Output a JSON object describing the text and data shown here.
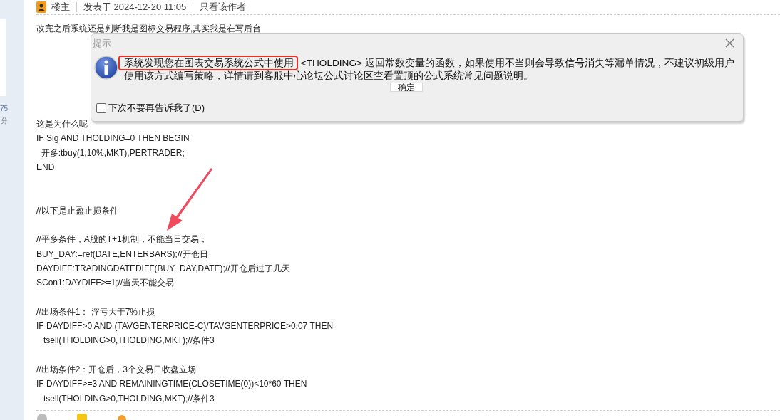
{
  "sidebar": {
    "stat_value": "75",
    "stat_unit": "分"
  },
  "post_header": {
    "role": "楼主",
    "posted": "发表于 2024-12-20 11:05",
    "author_only": "只看该作者"
  },
  "post_intro": "改完之后系统还是判断我是图标交易程序,其实我是在写后台",
  "dialog": {
    "title": "提示",
    "message_highlighted": "系统发现您在图表交易系统公式中使用",
    "message_rest": " <THOLDING> 返回常数变量的函数，如果使用不当则会导致信号消失等漏单情况，不建议初级用户使用该方式编写策略，详情请到客服中心论坛公式讨论区查看置顶的公式系统常见问题说明。",
    "ok_button": "确定",
    "dont_show_again": {
      "label": "下次不要再告诉我了(D)",
      "checked": false
    }
  },
  "code_blocks": [
    {
      "kind": "first",
      "lines": [
        "这是为什么呢",
        "IF Sig AND THOLDING=0 THEN BEGIN",
        "  开多:tbuy(1,10%,MKT),PERTRADER;",
        "END"
      ]
    },
    {
      "kind": "wide",
      "lines": [
        "//以下是止盈止损条件"
      ]
    },
    {
      "kind": "spaced",
      "lines": [
        "//平多条件，A股的T+1机制，不能当日交易；",
        "BUY_DAY:=ref(DATE,ENTERBARS);//开仓日",
        "DAYDIFF:TRADINGDATEDIFF(BUY_DAY,DATE);//开仓后过了几天",
        "SCon1:DAYDIFF>=1;//当天不能交易"
      ]
    },
    {
      "kind": "spaced",
      "lines": [
        "//出场条件1： 浮亏大于7%止损",
        "IF DAYDIFF>0 AND (TAVGENTERPRICE-C)/TAVGENTERPRICE>0.07 THEN",
        "   tsell(THOLDING>0,THOLDING,MKT);//条件3"
      ]
    },
    {
      "kind": "spaced",
      "lines": [
        "//出场条件2：开仓后，3个交易日收盘立场",
        "IF DAYDIFF>=3 AND REMAININGTIME(CLOSETIME(0))<10*60 THEN",
        "   tsell(THOLDING>0,THOLDING,MKT);//条件3"
      ]
    }
  ]
}
